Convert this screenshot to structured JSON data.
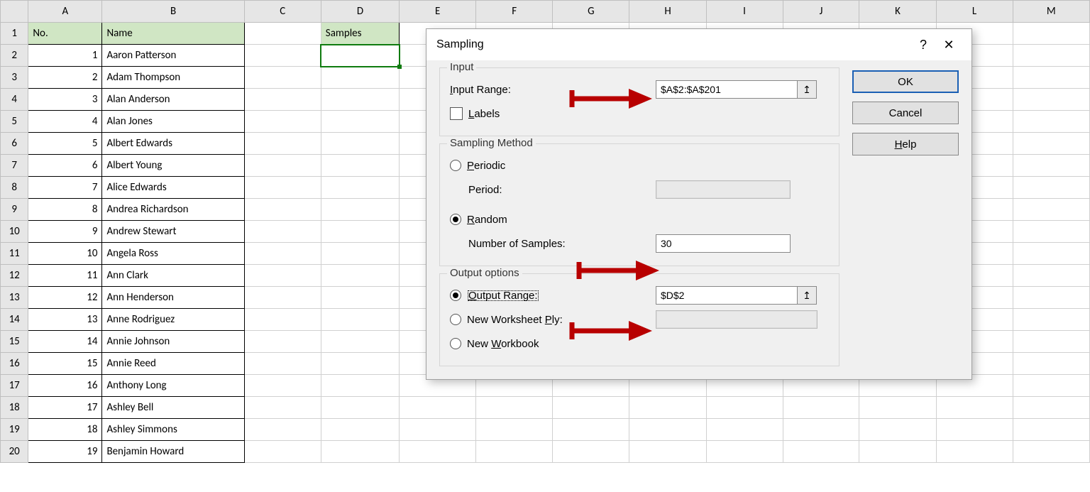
{
  "columns": [
    "A",
    "B",
    "C",
    "D",
    "E",
    "F",
    "G",
    "H",
    "I",
    "J",
    "K",
    "L",
    "M"
  ],
  "rowCount": 20,
  "headers": {
    "A": "No.",
    "B": "Name",
    "D": "Samples"
  },
  "data": [
    {
      "no": 1,
      "name": "Aaron Patterson"
    },
    {
      "no": 2,
      "name": "Adam Thompson"
    },
    {
      "no": 3,
      "name": "Alan Anderson"
    },
    {
      "no": 4,
      "name": "Alan Jones"
    },
    {
      "no": 5,
      "name": "Albert Edwards"
    },
    {
      "no": 6,
      "name": "Albert Young"
    },
    {
      "no": 7,
      "name": "Alice Edwards"
    },
    {
      "no": 8,
      "name": "Andrea Richardson"
    },
    {
      "no": 9,
      "name": "Andrew Stewart"
    },
    {
      "no": 10,
      "name": "Angela Ross"
    },
    {
      "no": 11,
      "name": "Ann Clark"
    },
    {
      "no": 12,
      "name": "Ann Henderson"
    },
    {
      "no": 13,
      "name": "Anne Rodriguez"
    },
    {
      "no": 14,
      "name": "Annie Johnson"
    },
    {
      "no": 15,
      "name": "Annie Reed"
    },
    {
      "no": 16,
      "name": "Anthony Long"
    },
    {
      "no": 17,
      "name": "Ashley Bell"
    },
    {
      "no": 18,
      "name": "Ashley Simmons"
    },
    {
      "no": 19,
      "name": "Benjamin Howard"
    }
  ],
  "dialog": {
    "title": "Sampling",
    "help_icon": "?",
    "close_icon": "✕",
    "input_group": "Input",
    "input_range_label_pre": "",
    "input_range_u": "I",
    "input_range_label_post": "nput Range:",
    "input_range_value": "$A$2:$A$201",
    "labels_u": "L",
    "labels_post": "abels",
    "method_group": "Sampling Method",
    "periodic_u": "P",
    "periodic_post": "eriodic",
    "period_label": "Period:",
    "random_u": "R",
    "random_post": "andom",
    "num_samples_label": "Number of Samples:",
    "num_samples_value": "30",
    "output_group": "Output options",
    "output_range_u": "O",
    "output_range_post": "utput Range:",
    "output_range_value": "$D$2",
    "wsply_pre": "New Worksheet ",
    "wsply_u": "P",
    "wsply_post": "ly:",
    "newwb_pre": "New ",
    "newwb_u": "W",
    "newwb_post": "orkbook",
    "ok": "OK",
    "cancel": "Cancel",
    "help_u": "H",
    "help_post": "elp"
  }
}
